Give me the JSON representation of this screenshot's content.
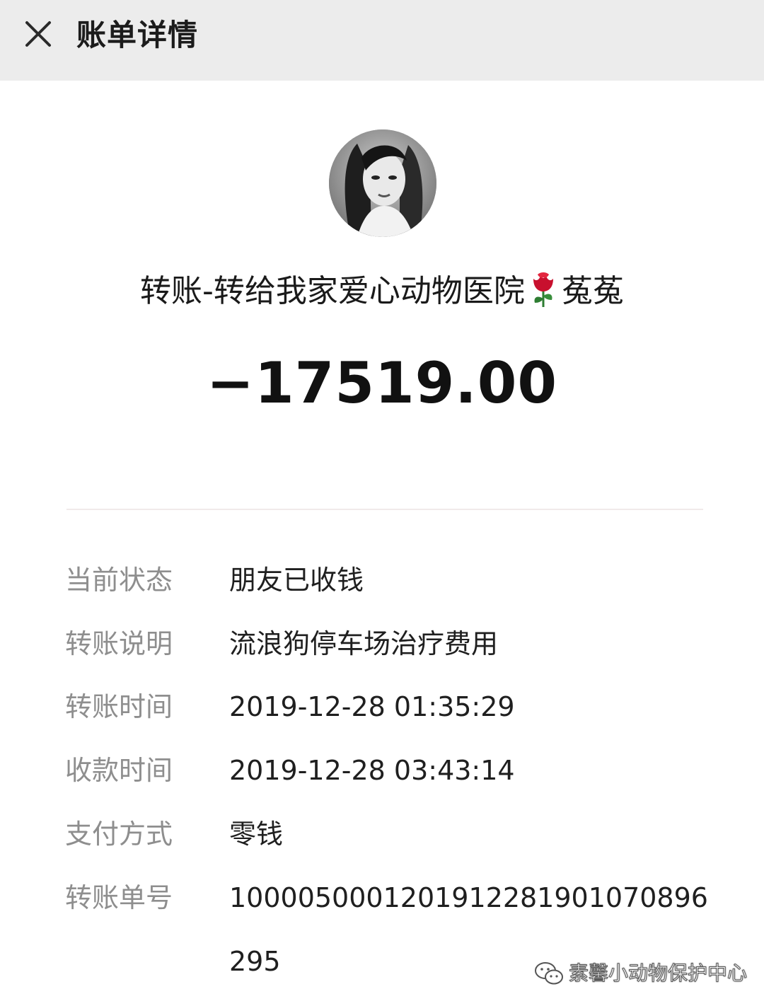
{
  "header": {
    "title": "账单详情",
    "close_icon": "close-icon"
  },
  "payee": {
    "avatar_icon": "avatar",
    "name_prefix": "转账-转给我家爱心动物医院",
    "emoji": "rose-icon",
    "name_suffix": "菟菟"
  },
  "amount": "−17519.00",
  "details": [
    {
      "label": "当前状态",
      "value": "朋友已收钱"
    },
    {
      "label": "转账说明",
      "value": "流浪狗停车场治疗费用"
    },
    {
      "label": "转账时间",
      "value": "2019-12-28 01:35:29"
    },
    {
      "label": "收款时间",
      "value": "2019-12-28 03:43:14"
    },
    {
      "label": "支付方式",
      "value": "零钱"
    },
    {
      "label": "转账单号",
      "value": "1000050001201912281901070896295"
    }
  ],
  "watermark": {
    "icon": "wechat-icon",
    "text": "素馨小动物保护中心"
  },
  "colors": {
    "topbar_bg": "#ececec",
    "label_text": "#8e8e8e",
    "value_text": "#1f1f1f",
    "rose": "#c8102e"
  }
}
